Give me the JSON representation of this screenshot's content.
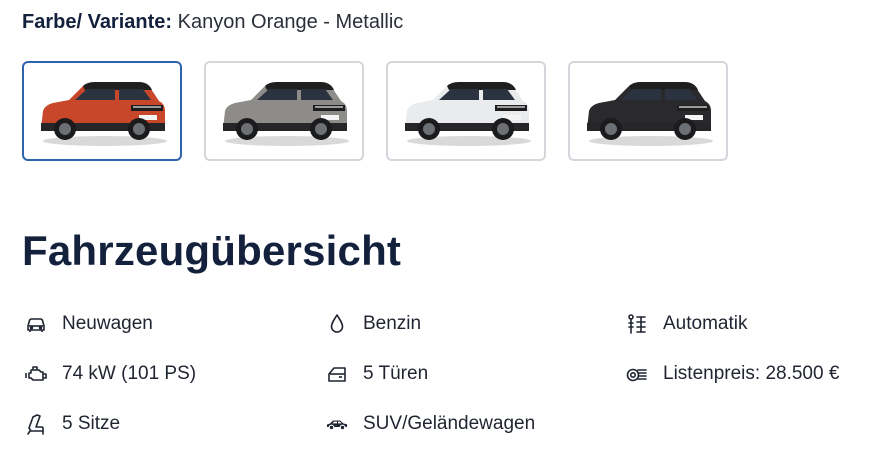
{
  "variant": {
    "label": "Farbe/ Variante:",
    "value": "Kanyon Orange - Metallic",
    "swatches": [
      {
        "name": "Kanyon Orange - Metallic",
        "body_color": "#c8462a",
        "roof_color": "#1f1f22",
        "selected": true
      },
      {
        "name": "silber-grey",
        "body_color": "#8e8c88",
        "roof_color": "#1f1f22",
        "selected": false
      },
      {
        "name": "white",
        "body_color": "#e9ebed",
        "roof_color": "#1f1f22",
        "selected": false
      },
      {
        "name": "black",
        "body_color": "#2a2a2d",
        "roof_color": "#1f1f22",
        "selected": false
      }
    ]
  },
  "overview": {
    "title": "Fahrzeugübersicht",
    "specs": [
      {
        "icon": "car-front-icon",
        "text": "Neuwagen"
      },
      {
        "icon": "fuel-drop-icon",
        "text": "Benzin"
      },
      {
        "icon": "gearbox-icon",
        "text": "Automatik"
      },
      {
        "icon": "engine-icon",
        "text": "74 kW (101 PS)"
      },
      {
        "icon": "car-door-icon",
        "text": "5 Türen"
      },
      {
        "icon": "price-tag-icon",
        "text": "Listenpreis: 28.500 €"
      },
      {
        "icon": "seat-icon",
        "text": "5 Sitze"
      },
      {
        "icon": "suv-icon",
        "text": "SUV/Geländewagen"
      }
    ]
  },
  "colors": {
    "heading": "#14213d",
    "selected_border": "#2e64ad",
    "swatch_border": "#d3d6da"
  }
}
